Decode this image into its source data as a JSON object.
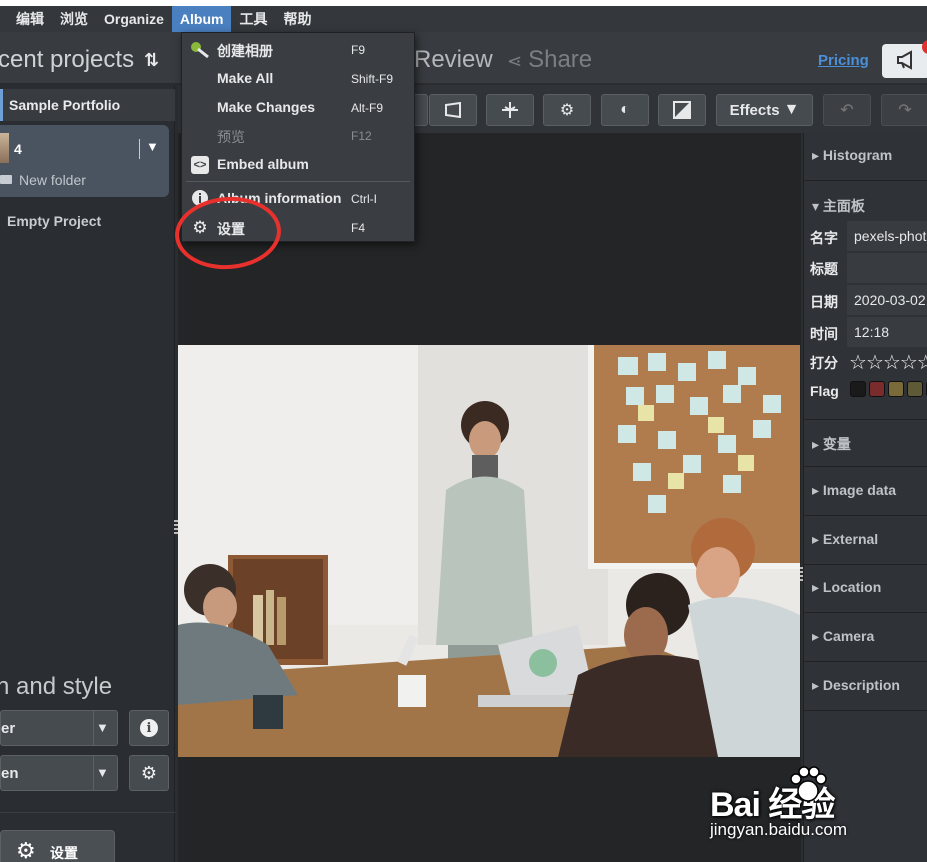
{
  "menubar": {
    "items": [
      "编辑",
      "浏览",
      "Organize",
      "Album",
      "工具",
      "帮助"
    ],
    "active": "Album"
  },
  "header": {
    "recent_projects_title": "cent projects",
    "sort_icon": "sort-arrows-icon",
    "review_tab": "Review",
    "share_tab": "Share",
    "share_icon": "share-icon",
    "pricing_link": "Pricing",
    "announce_icon": "megaphone-icon",
    "notification_color": "#e0322d"
  },
  "toolbar": {
    "effects_label": "Effects"
  },
  "left_panel": {
    "projects": {
      "sample": "Sample Portfolio",
      "selected_count": "4",
      "folder": "New folder",
      "empty": "Empty Project"
    },
    "design_title": "n and style",
    "select_1": "er",
    "select_2": "en",
    "settings_button": "设置"
  },
  "album_menu": {
    "items": [
      {
        "label": "创建相册",
        "shortcut": "F9",
        "icon": "create-album-icon",
        "enabled": true
      },
      {
        "label": "Make All",
        "shortcut": "Shift-F9",
        "icon": "",
        "enabled": true
      },
      {
        "label": "Make Changes",
        "shortcut": "Alt-F9",
        "icon": "",
        "enabled": true
      },
      {
        "label": "预览",
        "shortcut": "F12",
        "icon": "",
        "enabled": false
      },
      {
        "label": "Embed album",
        "shortcut": "",
        "icon": "embed-code-icon",
        "enabled": true
      },
      {
        "label": "Album information",
        "shortcut": "Ctrl-I",
        "icon": "info-icon",
        "enabled": true
      },
      {
        "label": "设置",
        "shortcut": "F4",
        "icon": "gear-icon",
        "enabled": true
      }
    ]
  },
  "right_panel": {
    "histogram": "▸ Histogram",
    "main_panel": "▾ 主面板",
    "fields": {
      "name_label": "名字",
      "name_value": "pexels-photo",
      "title_label": "标题",
      "title_value": "",
      "date_label": "日期",
      "date_value": "2020-03-02",
      "time_label": "时间",
      "time_value": "12:18",
      "rating_label": "打分",
      "rating": 0,
      "rating_max": 5,
      "flag_label": "Flag",
      "flag_colors": [
        "#1a1a1a",
        "#7a2b2b",
        "#7a6a3a",
        "#5e5a38",
        "#2f5d7a"
      ]
    },
    "sections": [
      "▸ 变量",
      "▸ Image data",
      "▸ External",
      "▸ Location",
      "▸ Camera",
      "▸ Description"
    ]
  },
  "watermark": {
    "brand": "Bai 经验",
    "url": "jingyan.baidu.com"
  },
  "annotation": {
    "highlight_color": "#e8312d"
  }
}
